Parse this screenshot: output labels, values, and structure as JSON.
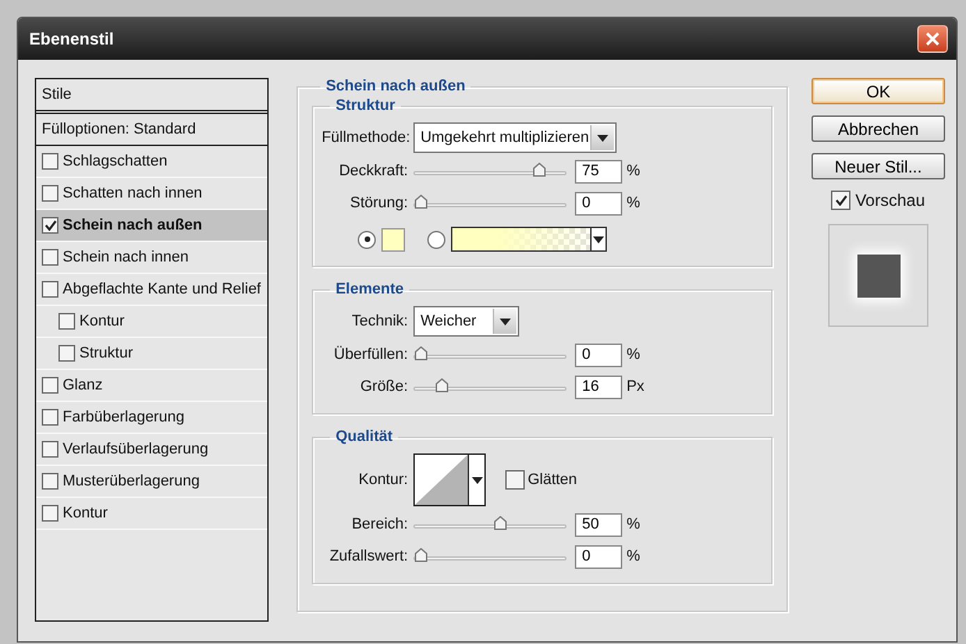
{
  "window": {
    "title": "Ebenenstil"
  },
  "styles_list": {
    "header": "Stile",
    "blend_options": "Fülloptionen: Standard",
    "items": [
      {
        "label": "Schlagschatten",
        "checked": false,
        "selected": false
      },
      {
        "label": "Schatten nach innen",
        "checked": false,
        "selected": false
      },
      {
        "label": "Schein nach außen",
        "checked": true,
        "selected": true
      },
      {
        "label": "Schein nach innen",
        "checked": false,
        "selected": false
      },
      {
        "label": "Abgeflachte Kante und Relief",
        "checked": false,
        "selected": false,
        "children": [
          {
            "label": "Kontur",
            "checked": false,
            "selected": false
          },
          {
            "label": "Struktur",
            "checked": false,
            "selected": false
          }
        ]
      },
      {
        "label": "Glanz",
        "checked": false,
        "selected": false
      },
      {
        "label": "Farbüberlagerung",
        "checked": false,
        "selected": false
      },
      {
        "label": "Verlaufsüberlagerung",
        "checked": false,
        "selected": false
      },
      {
        "label": "Musterüberlagerung",
        "checked": false,
        "selected": false
      },
      {
        "label": "Kontur",
        "checked": false,
        "selected": false
      }
    ]
  },
  "panel": {
    "title": "Schein nach außen",
    "groups": [
      {
        "title": "Struktur",
        "rows": [
          {
            "kind": "dropdown",
            "label": "Füllmethode:",
            "value": "Umgekehrt multiplizieren"
          },
          {
            "kind": "slider",
            "label": "Deckkraft:",
            "level": 0.77,
            "value": "75",
            "unit": "%"
          },
          {
            "kind": "slider",
            "label": "Störung:",
            "level": 0,
            "value": "0",
            "unit": "%"
          },
          {
            "kind": "fill",
            "color_selected": true,
            "gradient_selected": false
          }
        ]
      },
      {
        "title": "Elemente",
        "rows": [
          {
            "kind": "dropdown",
            "label": "Technik:",
            "value": "Weicher"
          },
          {
            "kind": "slider",
            "label": "Überfüllen:",
            "level": 0,
            "value": "0",
            "unit": "%"
          },
          {
            "kind": "slider",
            "label": "Größe:",
            "level": 0.14,
            "value": "16",
            "unit": "Px"
          }
        ]
      },
      {
        "title": "Qualität",
        "rows": [
          {
            "kind": "contour",
            "label": "Kontur:",
            "option": "Glätten",
            "checked": false
          },
          {
            "kind": "slider",
            "label": "Bereich:",
            "level": 0.52,
            "value": "50",
            "unit": "%"
          },
          {
            "kind": "slider",
            "label": "Zufallswert:",
            "level": 0,
            "value": "0",
            "unit": "%"
          }
        ]
      }
    ]
  },
  "buttons": [
    {
      "label": "OK",
      "default": true
    },
    {
      "label": "Abbrechen",
      "default": false
    },
    {
      "label": "Neuer Stil...",
      "default": false
    }
  ],
  "preview": {
    "label": "Vorschau",
    "checked": true
  }
}
